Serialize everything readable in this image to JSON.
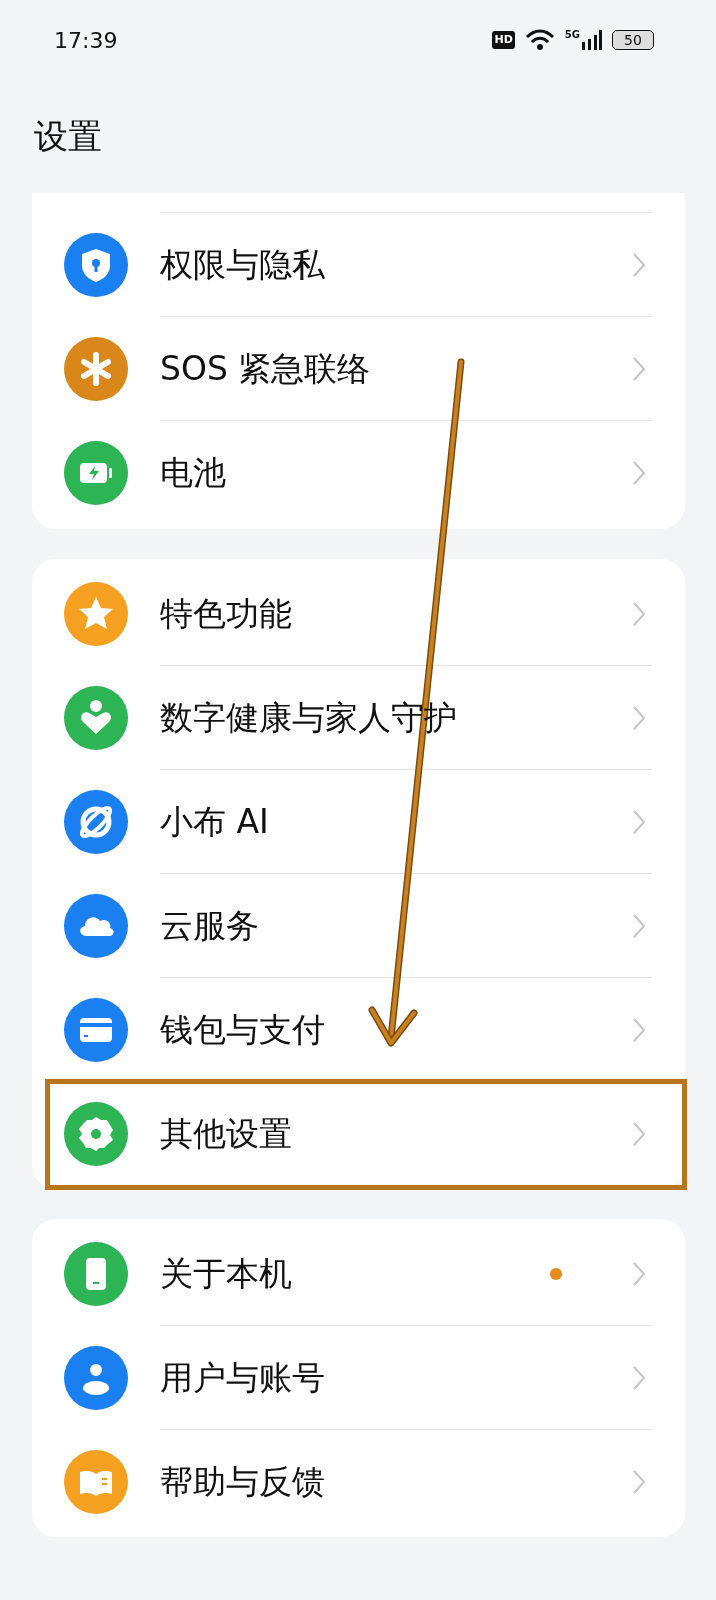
{
  "status_bar": {
    "time": "17:39",
    "hd": "HD",
    "network": "5G",
    "battery": "50"
  },
  "title": "设置",
  "groups": [
    {
      "items": [
        {
          "label": "权限与隐私",
          "color": "#1a7ff0",
          "dot": false,
          "highlighted": false
        },
        {
          "label": "SOS 紧急联络",
          "color": "#d9861a",
          "dot": false,
          "highlighted": false
        },
        {
          "label": "电池",
          "color": "#2db454",
          "dot": false,
          "highlighted": false
        }
      ]
    },
    {
      "items": [
        {
          "label": "特色功能",
          "color": "#f5a020",
          "dot": false,
          "highlighted": false
        },
        {
          "label": "数字健康与家人守护",
          "color": "#2db454",
          "dot": false,
          "highlighted": false
        },
        {
          "label": "小布 AI",
          "color": "#1a7ff0",
          "dot": false,
          "highlighted": false
        },
        {
          "label": "云服务",
          "color": "#1a7ff0",
          "dot": false,
          "highlighted": false
        },
        {
          "label": "钱包与支付",
          "color": "#1a7ff0",
          "dot": false,
          "highlighted": false
        },
        {
          "label": "其他设置",
          "color": "#2db454",
          "dot": false,
          "highlighted": true
        }
      ]
    },
    {
      "items": [
        {
          "label": "关于本机",
          "color": "#2db454",
          "dot": true,
          "highlighted": false
        },
        {
          "label": "用户与账号",
          "color": "#1a7ff0",
          "dot": false,
          "highlighted": false
        },
        {
          "label": "帮助与反馈",
          "color": "#f5a020",
          "dot": false,
          "highlighted": false
        }
      ]
    }
  ]
}
